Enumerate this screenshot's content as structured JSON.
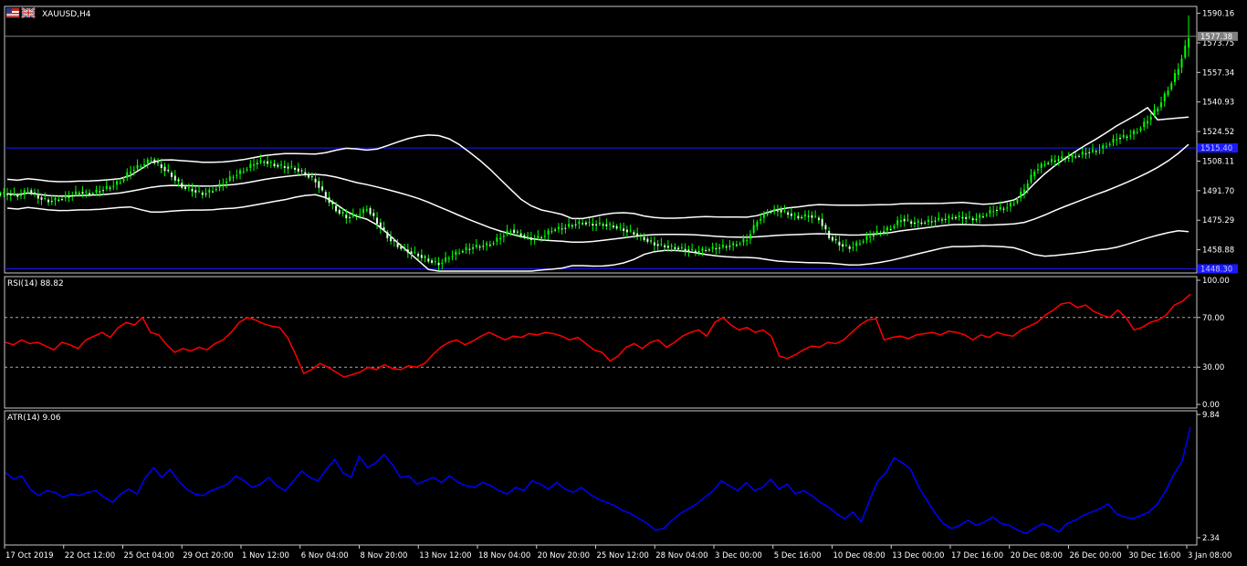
{
  "window": {
    "symbol_title": "XAUUSD,H4",
    "flag_icons": [
      "uk-flag-icon",
      "us-flag-icon"
    ]
  },
  "colors": {
    "background": "#000000",
    "frame": "#c8c8c8",
    "candle_up": "#00ff00",
    "candle_down": "#e0ffe0",
    "bands": "#ffffff",
    "rsi": "#ff0000",
    "atr": "#0000ff",
    "hline": "#1a1aff",
    "current_price_line": "#808080"
  },
  "chart_data": [
    {
      "type": "candlestick",
      "title": "XAUUSD,H4",
      "ylim": [
        1446,
        1594
      ],
      "y_ticks": [
        "1590.16",
        "1573.75",
        "1557.34",
        "1540.93",
        "1524.52",
        "1508.11",
        "1491.70",
        "1475.29",
        "1458.88"
      ],
      "current_price": "1577.38",
      "horizontal_lines": [
        {
          "value": 1515.4,
          "label": "1515.40"
        },
        {
          "value": 1448.3,
          "label": "1448.30"
        }
      ],
      "indicator": "Bollinger Bands",
      "closes": [
        1490,
        1489,
        1492,
        1488,
        1486,
        1487,
        1489,
        1491,
        1490,
        1492,
        1494,
        1497,
        1503,
        1506,
        1509,
        1505,
        1500,
        1494,
        1492,
        1490,
        1492,
        1496,
        1500,
        1503,
        1507,
        1508,
        1506,
        1505,
        1504,
        1501,
        1497,
        1488,
        1481,
        1477,
        1478,
        1482,
        1474,
        1466,
        1461,
        1458,
        1456,
        1453,
        1451,
        1455,
        1458,
        1460,
        1461,
        1462,
        1466,
        1470,
        1467,
        1465,
        1466,
        1470,
        1471,
        1473,
        1474,
        1473,
        1473,
        1472,
        1470,
        1468,
        1465,
        1462,
        1461,
        1460,
        1459,
        1458,
        1459,
        1460,
        1461,
        1462,
        1465,
        1475,
        1480,
        1481,
        1479,
        1477,
        1478,
        1476,
        1466,
        1462,
        1460,
        1463,
        1467,
        1469,
        1471,
        1476,
        1474,
        1474,
        1475,
        1476,
        1477,
        1477,
        1476,
        1478,
        1481,
        1482,
        1485,
        1493,
        1503,
        1507,
        1509,
        1510,
        1511,
        1513,
        1514,
        1517,
        1521,
        1522,
        1525,
        1531,
        1538,
        1548,
        1560,
        1577
      ],
      "upper_band_reached": 1531,
      "x_ticks": [
        "17 Oct 2019",
        "22 Oct 12:00",
        "25 Oct 04:00",
        "29 Oct 20:00",
        "1 Nov 12:00",
        "6 Nov 04:00",
        "8 Nov 20:00",
        "13 Nov 12:00",
        "18 Nov 04:00",
        "20 Nov 20:00",
        "25 Nov 12:00",
        "28 Nov 04:00",
        "3 Dec 00:00",
        "5 Dec 16:00",
        "10 Dec 08:00",
        "13 Dec 00:00",
        "17 Dec 16:00",
        "20 Dec 08:00",
        "26 Dec 00:00",
        "30 Dec 16:00",
        "3 Jan 08:00"
      ]
    },
    {
      "type": "line",
      "title": "RSI(14) 88.82",
      "ylim": [
        0,
        100
      ],
      "y_ticks": [
        "100.00",
        "70.00",
        "30.00",
        "0.00"
      ],
      "levels": [
        70,
        30
      ],
      "series": [
        {
          "values": [
            50,
            48,
            52,
            49,
            50,
            47,
            44,
            50,
            48,
            45,
            52,
            55,
            58,
            54,
            62,
            66,
            64,
            70,
            58,
            56,
            48,
            42,
            45,
            43,
            46,
            44,
            49,
            52,
            58,
            66,
            70,
            68,
            65,
            63,
            62,
            54,
            40,
            25,
            28,
            33,
            30,
            26,
            22,
            24,
            26,
            30,
            28,
            32,
            29,
            28,
            31,
            30,
            33,
            40,
            46,
            50,
            52,
            48,
            51,
            55,
            58,
            55,
            52,
            55,
            54,
            57,
            56,
            58,
            57,
            55,
            52,
            54,
            49,
            44,
            42,
            35,
            39,
            46,
            49,
            45,
            50,
            52,
            46,
            50,
            55,
            58,
            60,
            55,
            66,
            70,
            64,
            60,
            62,
            58,
            60,
            55,
            39,
            37,
            40,
            44,
            47,
            46,
            50,
            49,
            52,
            58,
            64,
            68,
            69,
            52,
            54,
            55,
            53,
            56,
            57,
            58,
            56,
            59,
            58,
            56,
            52,
            56,
            54,
            58,
            56,
            55,
            60,
            63,
            66,
            72,
            76,
            81,
            82,
            78,
            80,
            75,
            72,
            70,
            76,
            70,
            60,
            62,
            66,
            68,
            72,
            80,
            83,
            88.82
          ]
        }
      ]
    },
    {
      "type": "line",
      "title": "ATR(14) 9.06",
      "ylim": [
        2.34,
        9.84
      ],
      "y_ticks": [
        "9.84",
        "2.34"
      ],
      "series": [
        {
          "values": [
            6.3,
            5.9,
            6.1,
            5.3,
            4.9,
            5.2,
            5.1,
            4.8,
            5.0,
            4.9,
            5.1,
            5.2,
            4.8,
            4.5,
            5.0,
            5.3,
            5.0,
            6.0,
            6.6,
            6.0,
            6.5,
            5.8,
            5.3,
            5.0,
            4.9,
            5.2,
            5.4,
            5.6,
            6.1,
            5.8,
            5.4,
            5.6,
            6.0,
            5.5,
            5.2,
            5.8,
            6.4,
            6.0,
            5.8,
            6.5,
            7.1,
            6.3,
            6.0,
            7.3,
            6.6,
            6.9,
            7.4,
            6.8,
            6.0,
            6.1,
            5.6,
            5.8,
            6.0,
            5.7,
            6.1,
            5.7,
            5.5,
            5.4,
            5.7,
            5.5,
            5.2,
            5.0,
            5.4,
            5.2,
            5.8,
            5.6,
            5.3,
            5.7,
            5.3,
            5.1,
            5.4,
            5.0,
            4.7,
            4.5,
            4.3,
            4.0,
            3.8,
            3.5,
            3.2,
            2.8,
            2.9,
            3.4,
            3.8,
            4.1,
            4.4,
            4.8,
            5.2,
            5.8,
            5.5,
            5.2,
            5.7,
            5.2,
            5.4,
            5.9,
            5.3,
            5.6,
            5.0,
            5.2,
            4.9,
            4.5,
            4.2,
            3.8,
            3.5,
            3.9,
            3.3,
            4.6,
            5.8,
            6.3,
            7.2,
            6.9,
            6.5,
            5.4,
            4.6,
            3.8,
            3.2,
            2.9,
            3.1,
            3.4,
            3.1,
            3.3,
            3.6,
            3.2,
            3.1,
            2.8,
            2.6,
            2.9,
            3.2,
            3.0,
            2.7,
            3.2,
            3.4,
            3.7,
            3.9,
            4.1,
            4.4,
            3.8,
            3.6,
            3.5,
            3.7,
            3.9,
            4.4,
            5.2,
            6.2,
            7.0,
            9.06
          ]
        }
      ]
    }
  ]
}
